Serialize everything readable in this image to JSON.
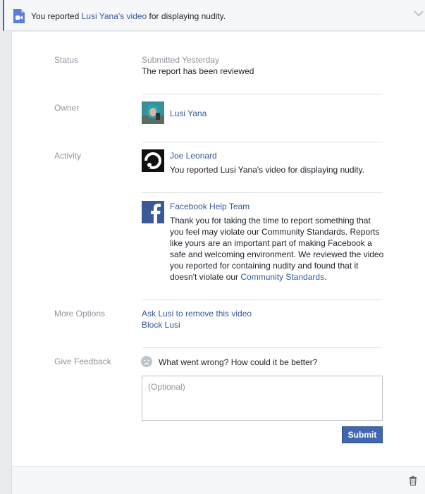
{
  "header": {
    "prefix": "You reported ",
    "owner_name": "Lusi Yana's",
    "owner_suffix": " video",
    "suffix": " for displaying nudity.",
    "icon": "video-report-icon",
    "collapse_icon": "chevron-down-icon"
  },
  "status": {
    "label": "Status",
    "submitted": "Submitted Yesterday",
    "state": "The report has been reviewed"
  },
  "owner": {
    "label": "Owner",
    "name": "Lusi Yana"
  },
  "activity": {
    "label": "Activity",
    "entries": [
      {
        "name": "Joe Leonard",
        "text": "You reported Lusi Yana's video for displaying nudity."
      },
      {
        "name": "Facebook Help Team",
        "text_main": "Thank you for taking the time to report something that you feel may violate our Community Standards. Reports like yours are an important part of making Facebook a safe and welcoming environment. We reviewed the video you reported for containing nudity and found that it doesn't violate our ",
        "link": "Community Standards",
        "text_end": "."
      }
    ]
  },
  "more_options": {
    "label": "More Options",
    "items": [
      "Ask Lusi to remove this video",
      "Block Lusi"
    ]
  },
  "feedback": {
    "label": "Give Feedback",
    "question": "What went wrong? How could it be better?",
    "placeholder": "(Optional)",
    "value": "",
    "submit_label": "Submit"
  },
  "colors": {
    "accent": "#4267b2",
    "link": "#365899",
    "muted": "#90949c"
  }
}
